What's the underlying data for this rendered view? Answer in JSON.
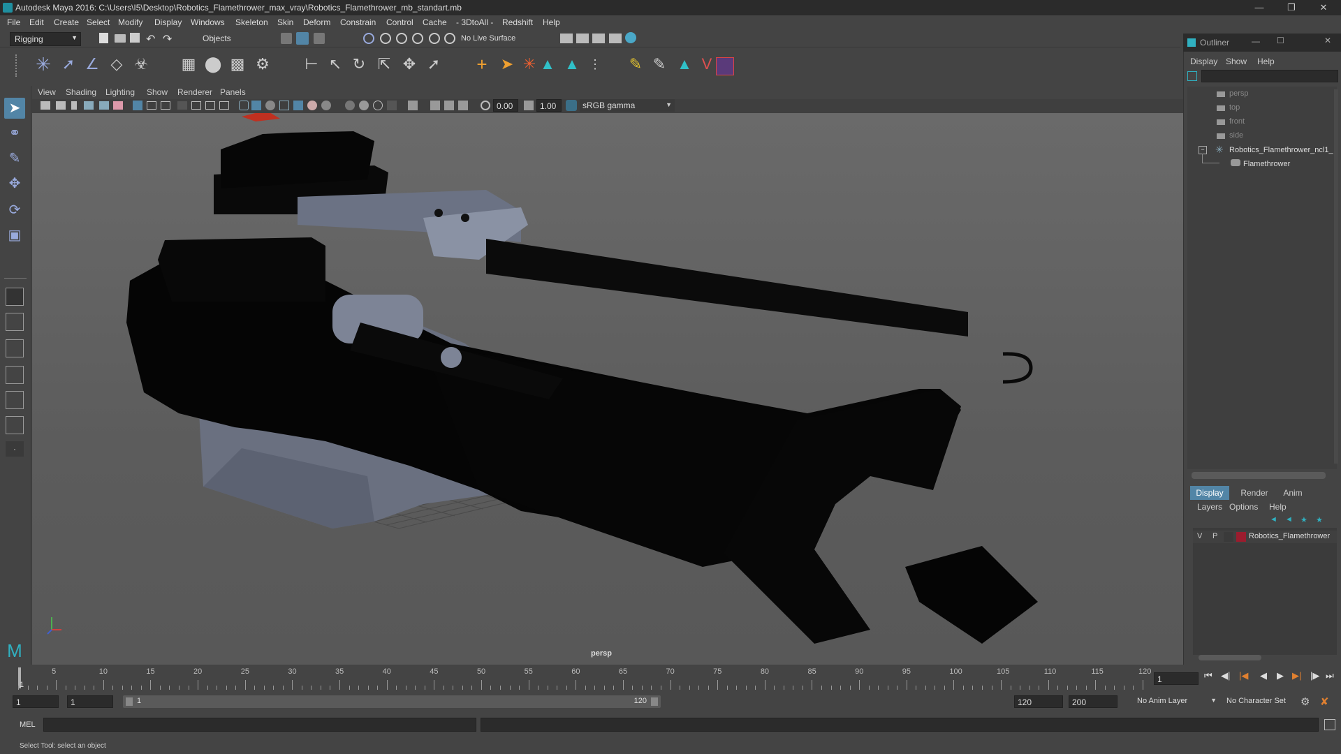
{
  "window": {
    "title": "Autodesk Maya 2016: C:\\Users\\I5\\Desktop\\Robotics_Flamethrower_max_vray\\Robotics_Flamethrower_mb_standart.mb"
  },
  "menubar": [
    "File",
    "Edit",
    "Create",
    "Select",
    "Modify",
    "Display",
    "Windows",
    "Skeleton",
    "Skin",
    "Deform",
    "Constrain",
    "Control",
    "Cache",
    "- 3DtoAll -",
    "Redshift",
    "Help"
  ],
  "statusline": {
    "mode": "Rigging",
    "selection_mask": "Objects",
    "live_surface": "No Live Surface"
  },
  "viewport": {
    "menus": [
      "View",
      "Shading",
      "Lighting",
      "Show",
      "Renderer",
      "Panels"
    ],
    "camera_label": "persp",
    "exposure": "0.00",
    "gamma": "1.00",
    "color_space": "sRGB gamma"
  },
  "outliner": {
    "title": "Outliner",
    "menus": [
      "Display",
      "Show",
      "Help"
    ],
    "items": [
      {
        "label": "persp",
        "kind": "camera"
      },
      {
        "label": "top",
        "kind": "camera"
      },
      {
        "label": "front",
        "kind": "camera"
      },
      {
        "label": "side",
        "kind": "camera"
      },
      {
        "label": "Robotics_Flamethrower_ncl1_",
        "kind": "group"
      },
      {
        "label": "Flamethrower",
        "kind": "mesh"
      }
    ]
  },
  "layer_editor": {
    "tabs": [
      "Display",
      "Render",
      "Anim"
    ],
    "menus": [
      "Layers",
      "Options",
      "Help"
    ],
    "layer": {
      "v": "V",
      "p": "P",
      "name": "Robotics_Flamethrower",
      "color": "#9b1c2e"
    }
  },
  "timeline": {
    "ticks": [
      "5",
      "10",
      "15",
      "20",
      "25",
      "30",
      "35",
      "40",
      "45",
      "50",
      "55",
      "60",
      "65",
      "70",
      "75",
      "80",
      "85",
      "90",
      "95",
      "100",
      "105",
      "110",
      "115",
      "120"
    ],
    "start_frame_label": "1",
    "current_frame": "1"
  },
  "range": {
    "start": "1",
    "playback_start": "1",
    "slider_start": "1",
    "slider_end": "120",
    "playback_end": "120",
    "end": "200",
    "anim_layer": "No Anim Layer",
    "character_set": "No Character Set"
  },
  "cmdline": {
    "label": "MEL"
  },
  "helpline": {
    "text": "Select Tool: select an object"
  },
  "colors": {
    "accent": "#5285a6",
    "ui": "#444444",
    "dark": "#2b2b2b",
    "layer": "#9b1c2e"
  }
}
